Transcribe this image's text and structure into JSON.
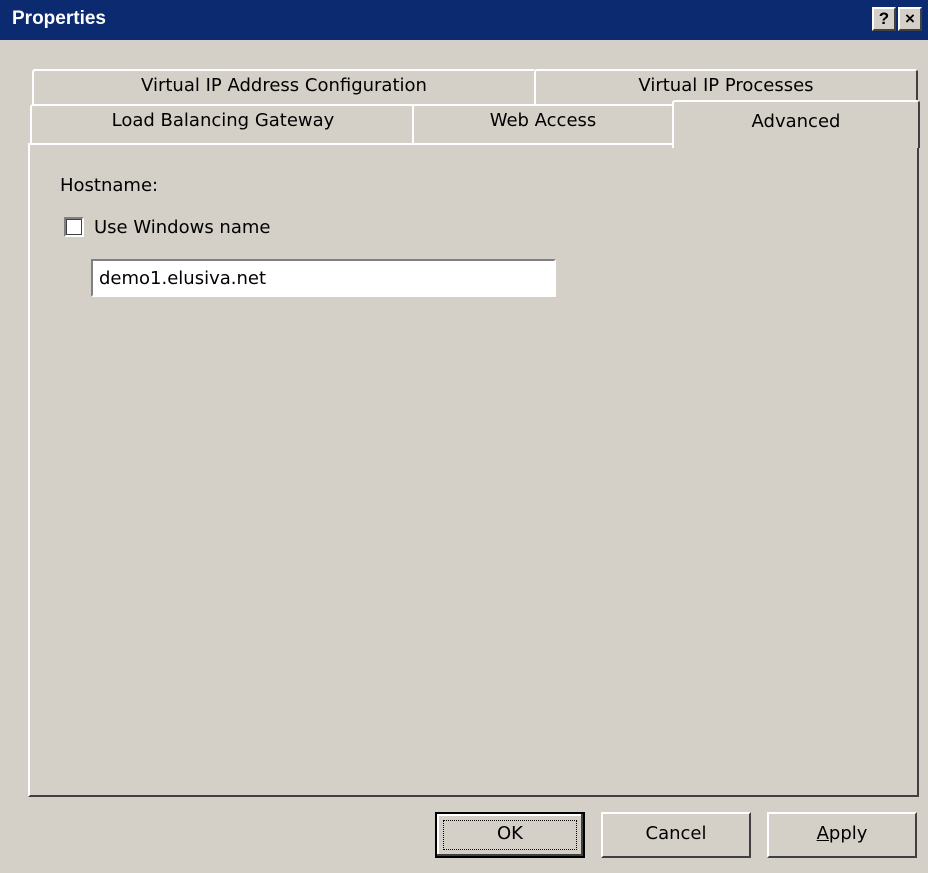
{
  "window": {
    "title": "Properties",
    "help_button": "?",
    "close_button": "×"
  },
  "tabs": {
    "row1": [
      {
        "label": "Virtual IP Address Configuration"
      },
      {
        "label": "Virtual IP Processes"
      }
    ],
    "row2": [
      {
        "label": "Load Balancing Gateway"
      },
      {
        "label": "Web Access"
      },
      {
        "label": "Advanced",
        "active": true
      }
    ]
  },
  "advanced": {
    "hostname_label": "Hostname:",
    "use_windows_name_label": "Use Windows name",
    "use_windows_name_checked": false,
    "hostname_value": "demo1.elusiva.net"
  },
  "buttons": {
    "ok": "OK",
    "cancel": "Cancel",
    "apply_first": "A",
    "apply_rest": "pply"
  }
}
